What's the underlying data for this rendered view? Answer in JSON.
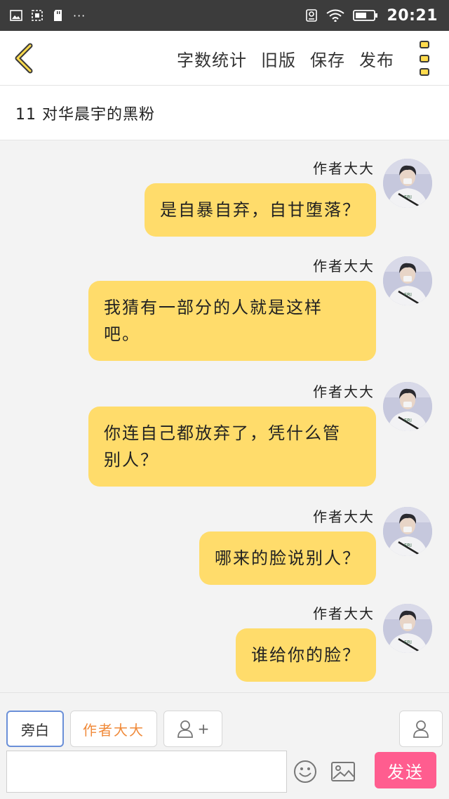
{
  "status_bar": {
    "time": "20:21",
    "more": "···"
  },
  "toolbar": {
    "actions": [
      "字数统计",
      "旧版",
      "保存",
      "发布"
    ]
  },
  "chapter": {
    "title": "11 对华晨宇的黑粉"
  },
  "messages": [
    {
      "author": "作者大大",
      "lines": [
        "是自暴自弃，自甘堕落？"
      ]
    },
    {
      "author": "作者大大",
      "lines": [
        "我猜有一部分的人就是这样",
        "吧。"
      ]
    },
    {
      "author": "作者大大",
      "lines": [
        "你连自己都放弃了，凭什么管",
        "别人？"
      ]
    },
    {
      "author": "作者大大",
      "lines": [
        "哪来的脸说别人？"
      ]
    },
    {
      "author": "作者大大",
      "lines": [
        "谁给你的脸？"
      ]
    }
  ],
  "composer": {
    "narration_label": "旁白",
    "author_label": "作者大大",
    "add_role_label": "+",
    "input_value": "",
    "send_label": "发送"
  },
  "colors": {
    "bubble": "#ffdc6b",
    "send": "#ff5d8f",
    "author_tag": "#f08a3a",
    "selected_border": "#6a8fd8"
  }
}
